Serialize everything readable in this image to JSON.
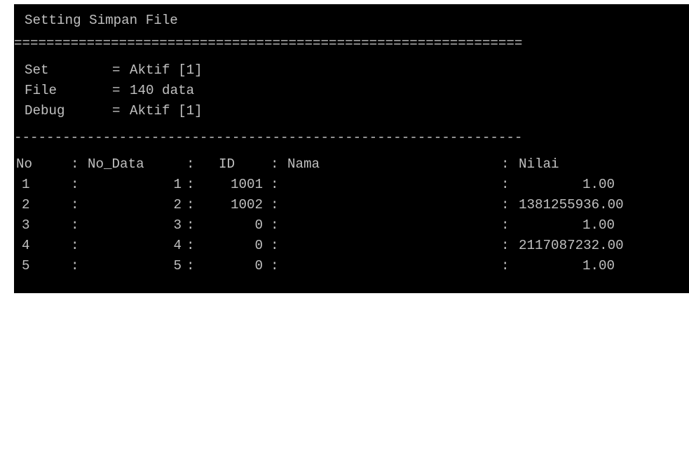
{
  "window_title": "Setting Simpan File",
  "double_rule": "===============================================================",
  "single_rule": "---------------------------------------------------------------",
  "settings": [
    {
      "key": "Set",
      "sep": "=",
      "value": "Aktif [1]"
    },
    {
      "key": "File",
      "sep": "=",
      "value": "140 data"
    },
    {
      "key": "Debug",
      "sep": "=",
      "value": "Aktif [1]"
    }
  ],
  "table": {
    "separator": ":",
    "headers": {
      "no": "No",
      "no_data": "No_Data",
      "id": "ID",
      "nama": "Nama",
      "nilai": "Nilai"
    },
    "rows": [
      {
        "no": "1",
        "no_data": "1",
        "id": "1001",
        "nama": "",
        "nilai": "1.00"
      },
      {
        "no": "2",
        "no_data": "2",
        "id": "1002",
        "nama": "",
        "nilai": "1381255936.00"
      },
      {
        "no": "3",
        "no_data": "3",
        "id": "0",
        "nama": "",
        "nilai": "1.00"
      },
      {
        "no": "4",
        "no_data": "4",
        "id": "0",
        "nama": "",
        "nilai": "2117087232.00"
      },
      {
        "no": "5",
        "no_data": "5",
        "id": "0",
        "nama": "",
        "nilai": "1.00"
      }
    ]
  }
}
